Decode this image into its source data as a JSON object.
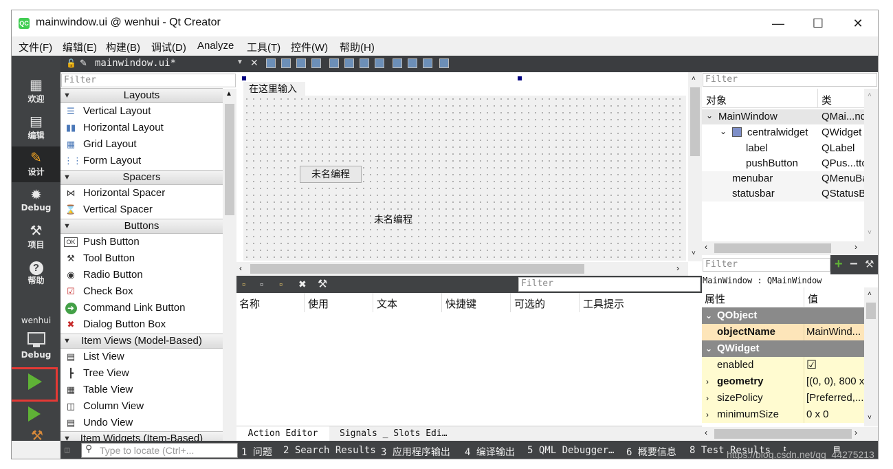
{
  "window": {
    "title": "mainwindow.ui @ wenhui - Qt Creator",
    "app_icon": "QC"
  },
  "menu": [
    "文件(F)",
    "编辑(E)",
    "构建(B)",
    "调试(D)",
    "Analyze",
    "工具(T)",
    "控件(W)",
    "帮助(H)"
  ],
  "modes": [
    {
      "label": "欢迎",
      "icon": "grid-icon"
    },
    {
      "label": "编辑",
      "icon": "document-icon"
    },
    {
      "label": "设计",
      "icon": "pencil-icon"
    },
    {
      "label": "Debug",
      "icon": "bug-icon"
    },
    {
      "label": "项目",
      "icon": "wrench-icon"
    },
    {
      "label": "帮助",
      "icon": "help-icon"
    }
  ],
  "kit": {
    "name": "wenhui",
    "mode": "Debug"
  },
  "editor_tab": {
    "file": "mainwindow.ui*"
  },
  "widget_box": {
    "filter_placeholder": "Filter",
    "categories": [
      {
        "name": "Layouts",
        "items": [
          "Vertical Layout",
          "Horizontal Layout",
          "Grid Layout",
          "Form Layout"
        ]
      },
      {
        "name": "Spacers",
        "items": [
          "Horizontal Spacer",
          "Vertical Spacer"
        ]
      },
      {
        "name": "Buttons",
        "items": [
          "Push Button",
          "Tool Button",
          "Radio Button",
          "Check Box",
          "Command Link Button",
          "Dialog Button Box"
        ]
      },
      {
        "name": "Item Views (Model-Based)",
        "items": [
          "List View",
          "Tree View",
          "Table View",
          "Column View",
          "Undo View"
        ]
      },
      {
        "name": "Item Widgets (Item-Based)",
        "items": []
      }
    ]
  },
  "form": {
    "menu_placeholder": "在这里输入",
    "button_text": "未名编程",
    "label_text": "未名编程"
  },
  "action_editor": {
    "filter_placeholder": "Filter",
    "columns": [
      "名称",
      "使用",
      "文本",
      "快捷键",
      "可选的",
      "工具提示"
    ],
    "tabs": [
      "Action Editor",
      "Signals _ Slots Edi…"
    ]
  },
  "object_inspector": {
    "filter_placeholder": "Filter",
    "columns": [
      "对象",
      "类"
    ],
    "rows": [
      {
        "object": "MainWindow",
        "class": "QMai...ndow",
        "indent": 0,
        "expanded": true
      },
      {
        "object": "centralwidget",
        "class": "QWidget",
        "indent": 1,
        "expanded": true
      },
      {
        "object": "label",
        "class": "QLabel",
        "indent": 2
      },
      {
        "object": "pushButton",
        "class": "QPus...tton",
        "indent": 2
      },
      {
        "object": "menubar",
        "class": "QMenuBar",
        "indent": 1
      },
      {
        "object": "statusbar",
        "class": "QStatusBar",
        "indent": 1
      }
    ]
  },
  "property_editor": {
    "filter_placeholder": "Filter",
    "header": "MainWindow : QMainWindow",
    "columns": [
      "属性",
      "值"
    ],
    "rows": [
      {
        "type": "group",
        "name": "QObject"
      },
      {
        "type": "prop",
        "name": "objectName",
        "value": "MainWind...",
        "bold": true
      },
      {
        "type": "group",
        "name": "QWidget"
      },
      {
        "type": "prop",
        "name": "enabled",
        "value": "☑",
        "bold": false
      },
      {
        "type": "prop",
        "name": "geometry",
        "value": "[(0, 0), 800 x",
        "bold": true,
        "expandable": true
      },
      {
        "type": "prop",
        "name": "sizePolicy",
        "value": "[Preferred,...",
        "bold": false,
        "expandable": true
      },
      {
        "type": "prop",
        "name": "minimumSize",
        "value": "0 x 0",
        "bold": false,
        "expandable": true
      }
    ]
  },
  "statusbar": {
    "locator_placeholder": "Type to locate (Ctrl+...",
    "panes": [
      "1 问题",
      "2 Search Results",
      "3 应用程序输出",
      "4 编译输出",
      "5 QML Debugger…",
      "6 概要信息",
      "8 Test Results"
    ]
  },
  "watermark": "https://blog.csdn.net/qq_44275213",
  "colors": {
    "accent_run": "#5fb236",
    "highlight_box": "#e53935",
    "prop_yellow": "#fffbd0",
    "prop_orange": "#fde5b9",
    "group_gray": "#8a8a8a"
  }
}
